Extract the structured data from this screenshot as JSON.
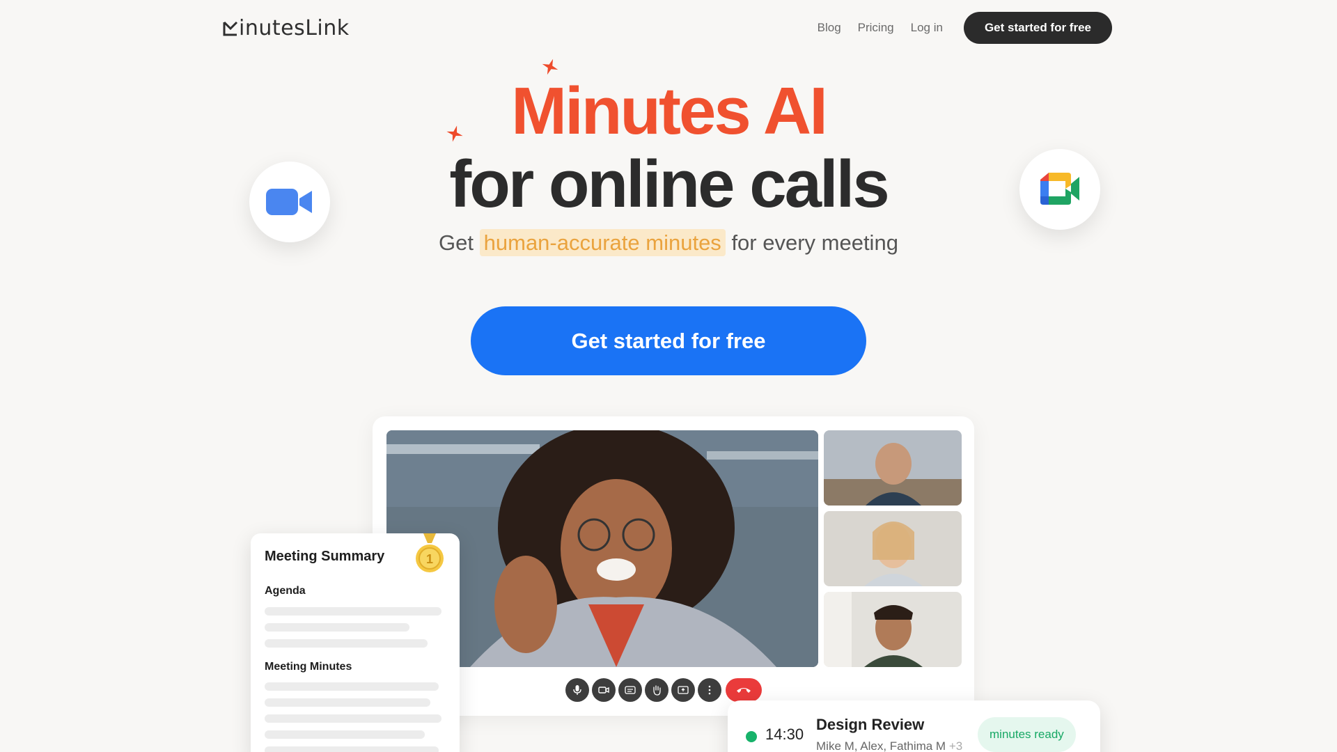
{
  "nav": {
    "logo_text": "inutesLink",
    "links": [
      "Blog",
      "Pricing",
      "Log in"
    ],
    "cta": "Get started for free"
  },
  "hero": {
    "title_line1": "Minutes AI",
    "title_line2": "for online calls",
    "subtitle_prefix": "Get",
    "subtitle_highlight": "human-accurate minutes",
    "subtitle_suffix": "for every meeting",
    "cta": "Get started for free"
  },
  "apps": {
    "left_icon": "zoom-camera-icon",
    "right_icon": "google-meet-icon"
  },
  "call": {
    "controls": [
      "microphone-icon",
      "video-camera-icon",
      "captions-icon",
      "raise-hand-icon",
      "screen-share-icon",
      "more-options-icon",
      "end-call-icon"
    ]
  },
  "summary": {
    "title": "Meeting Summary",
    "section1": "Agenda",
    "section2": "Meeting Minutes",
    "badge_icon": "medal-icon",
    "badge_number": "1"
  },
  "notification": {
    "time": "14:30",
    "title": "Design Review",
    "people": "Mike M, Alex, Fathima M",
    "more": "+3",
    "status": "minutes ready"
  },
  "colors": {
    "brand_orange": "#f0512f",
    "primary_blue": "#1a73f5",
    "dark": "#2b2b2b",
    "highlight_bg": "#fbe9c9",
    "highlight_text": "#eaa33e",
    "status_green": "#17b26a"
  }
}
